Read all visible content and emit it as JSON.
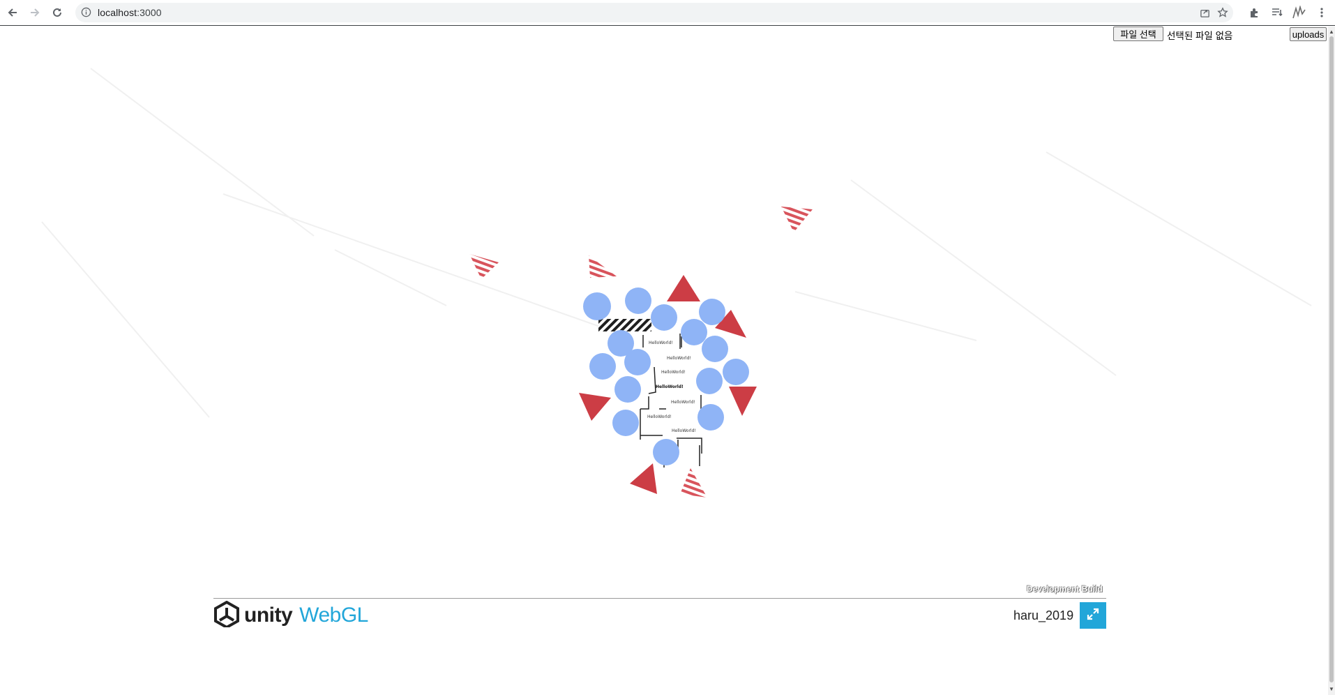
{
  "browser": {
    "url_host": "localhost",
    "url_port": ":3000",
    "icons": [
      "back-icon",
      "forward-icon",
      "reload-icon",
      "info-icon",
      "share-icon",
      "star-icon",
      "extensions-icon",
      "reading-list-icon",
      "profile-icon",
      "menu-icon"
    ]
  },
  "upload": {
    "choose_file_label": "파일 선택",
    "no_file_text": "선택된 파일 없음",
    "upload_label": "uploads"
  },
  "game": {
    "labels": [
      "HelloWorld!",
      "HelloWorld!",
      "HelloWorld!",
      "HelloWorld!",
      "HelloWorld!",
      "HelloWorld!",
      "HelloWorld!"
    ],
    "colors": {
      "circle": "#8fb4f6",
      "triangle": "#cc3d45",
      "stripe": "#d8545c"
    }
  },
  "footer": {
    "dev_build": "Development Build",
    "unity_text": "unity",
    "webgl_text": "WebGL",
    "title": "haru_2019",
    "accent": "#22a6d9"
  }
}
